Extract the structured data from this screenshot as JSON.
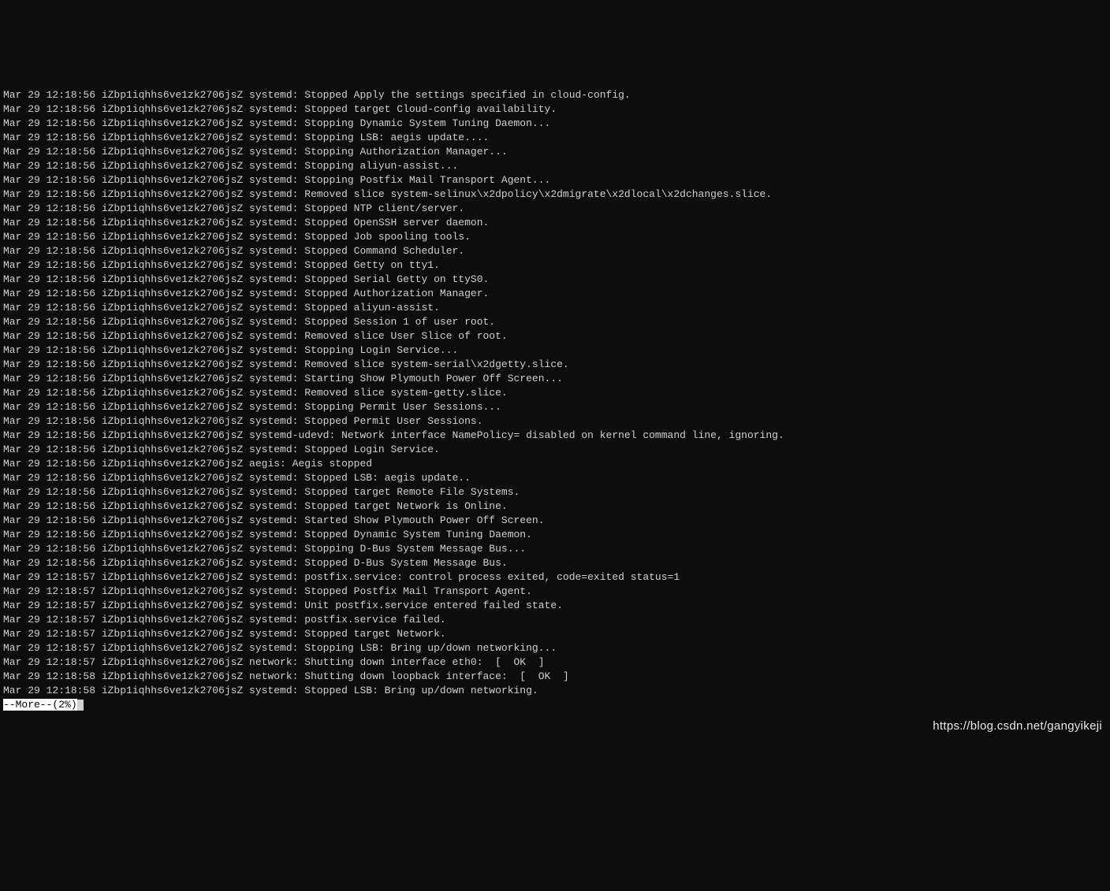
{
  "terminal": {
    "lines": [
      "Mar 29 12:18:56 iZbp1iqhhs6ve1zk2706jsZ systemd: Stopped Apply the settings specified in cloud-config.",
      "Mar 29 12:18:56 iZbp1iqhhs6ve1zk2706jsZ systemd: Stopped target Cloud-config availability.",
      "Mar 29 12:18:56 iZbp1iqhhs6ve1zk2706jsZ systemd: Stopping Dynamic System Tuning Daemon...",
      "Mar 29 12:18:56 iZbp1iqhhs6ve1zk2706jsZ systemd: Stopping LSB: aegis update....",
      "Mar 29 12:18:56 iZbp1iqhhs6ve1zk2706jsZ systemd: Stopping Authorization Manager...",
      "Mar 29 12:18:56 iZbp1iqhhs6ve1zk2706jsZ systemd: Stopping aliyun-assist...",
      "Mar 29 12:18:56 iZbp1iqhhs6ve1zk2706jsZ systemd: Stopping Postfix Mail Transport Agent...",
      "Mar 29 12:18:56 iZbp1iqhhs6ve1zk2706jsZ systemd: Removed slice system-selinux\\x2dpolicy\\x2dmigrate\\x2dlocal\\x2dchanges.slice.",
      "Mar 29 12:18:56 iZbp1iqhhs6ve1zk2706jsZ systemd: Stopped NTP client/server.",
      "Mar 29 12:18:56 iZbp1iqhhs6ve1zk2706jsZ systemd: Stopped OpenSSH server daemon.",
      "Mar 29 12:18:56 iZbp1iqhhs6ve1zk2706jsZ systemd: Stopped Job spooling tools.",
      "Mar 29 12:18:56 iZbp1iqhhs6ve1zk2706jsZ systemd: Stopped Command Scheduler.",
      "Mar 29 12:18:56 iZbp1iqhhs6ve1zk2706jsZ systemd: Stopped Getty on tty1.",
      "Mar 29 12:18:56 iZbp1iqhhs6ve1zk2706jsZ systemd: Stopped Serial Getty on ttyS0.",
      "Mar 29 12:18:56 iZbp1iqhhs6ve1zk2706jsZ systemd: Stopped Authorization Manager.",
      "Mar 29 12:18:56 iZbp1iqhhs6ve1zk2706jsZ systemd: Stopped aliyun-assist.",
      "Mar 29 12:18:56 iZbp1iqhhs6ve1zk2706jsZ systemd: Stopped Session 1 of user root.",
      "Mar 29 12:18:56 iZbp1iqhhs6ve1zk2706jsZ systemd: Removed slice User Slice of root.",
      "Mar 29 12:18:56 iZbp1iqhhs6ve1zk2706jsZ systemd: Stopping Login Service...",
      "Mar 29 12:18:56 iZbp1iqhhs6ve1zk2706jsZ systemd: Removed slice system-serial\\x2dgetty.slice.",
      "Mar 29 12:18:56 iZbp1iqhhs6ve1zk2706jsZ systemd: Starting Show Plymouth Power Off Screen...",
      "Mar 29 12:18:56 iZbp1iqhhs6ve1zk2706jsZ systemd: Removed slice system-getty.slice.",
      "Mar 29 12:18:56 iZbp1iqhhs6ve1zk2706jsZ systemd: Stopping Permit User Sessions...",
      "Mar 29 12:18:56 iZbp1iqhhs6ve1zk2706jsZ systemd: Stopped Permit User Sessions.",
      "Mar 29 12:18:56 iZbp1iqhhs6ve1zk2706jsZ systemd-udevd: Network interface NamePolicy= disabled on kernel command line, ignoring.",
      "Mar 29 12:18:56 iZbp1iqhhs6ve1zk2706jsZ systemd: Stopped Login Service.",
      "Mar 29 12:18:56 iZbp1iqhhs6ve1zk2706jsZ aegis: Aegis stopped",
      "Mar 29 12:18:56 iZbp1iqhhs6ve1zk2706jsZ systemd: Stopped LSB: aegis update..",
      "Mar 29 12:18:56 iZbp1iqhhs6ve1zk2706jsZ systemd: Stopped target Remote File Systems.",
      "Mar 29 12:18:56 iZbp1iqhhs6ve1zk2706jsZ systemd: Stopped target Network is Online.",
      "Mar 29 12:18:56 iZbp1iqhhs6ve1zk2706jsZ systemd: Started Show Plymouth Power Off Screen.",
      "Mar 29 12:18:56 iZbp1iqhhs6ve1zk2706jsZ systemd: Stopped Dynamic System Tuning Daemon.",
      "Mar 29 12:18:56 iZbp1iqhhs6ve1zk2706jsZ systemd: Stopping D-Bus System Message Bus...",
      "Mar 29 12:18:56 iZbp1iqhhs6ve1zk2706jsZ systemd: Stopped D-Bus System Message Bus.",
      "Mar 29 12:18:57 iZbp1iqhhs6ve1zk2706jsZ systemd: postfix.service: control process exited, code=exited status=1",
      "Mar 29 12:18:57 iZbp1iqhhs6ve1zk2706jsZ systemd: Stopped Postfix Mail Transport Agent.",
      "Mar 29 12:18:57 iZbp1iqhhs6ve1zk2706jsZ systemd: Unit postfix.service entered failed state.",
      "Mar 29 12:18:57 iZbp1iqhhs6ve1zk2706jsZ systemd: postfix.service failed.",
      "Mar 29 12:18:57 iZbp1iqhhs6ve1zk2706jsZ systemd: Stopped target Network.",
      "Mar 29 12:18:57 iZbp1iqhhs6ve1zk2706jsZ systemd: Stopping LSB: Bring up/down networking...",
      "Mar 29 12:18:57 iZbp1iqhhs6ve1zk2706jsZ network: Shutting down interface eth0:  [  OK  ]",
      "Mar 29 12:18:58 iZbp1iqhhs6ve1zk2706jsZ network: Shutting down loopback interface:  [  OK  ]",
      "Mar 29 12:18:58 iZbp1iqhhs6ve1zk2706jsZ systemd: Stopped LSB: Bring up/down networking."
    ],
    "more_prompt": "--More--(2%)"
  },
  "watermark": "https://blog.csdn.net/gangyikeji"
}
